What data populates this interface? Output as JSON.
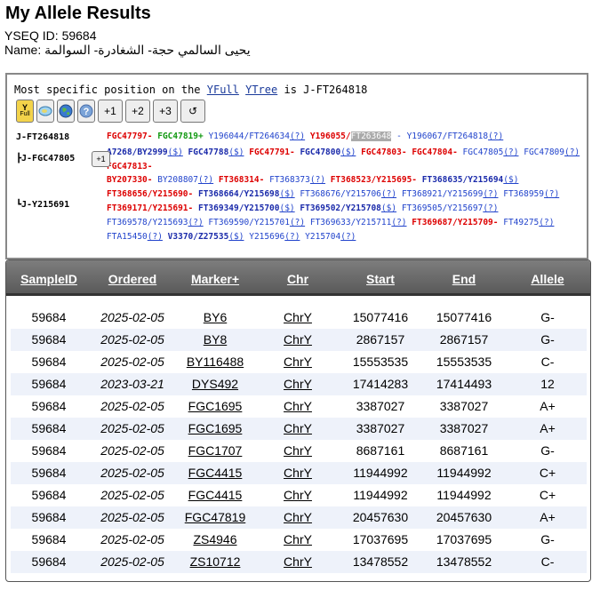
{
  "page": {
    "title": "My Allele Results",
    "yseq_id": "YSEQ ID: 59684",
    "name_line": "Name: يحيى السالمي حجة- الشغادرة- السوالمة"
  },
  "tree": {
    "position_prefix": "Most specific position on the",
    "yfull_link": "YFull",
    "ytree_link": "YTree",
    "position_suffix": "is J-FT264818",
    "toolbar": {
      "yfull_icon": "Y",
      "yfull_caption": "Full",
      "plus1": "+1",
      "plus2": "+2",
      "plus3": "+3",
      "reset": "↺"
    },
    "small_plus1": "+1",
    "branches": [
      {
        "label": "J-FT264818",
        "snps": [
          {
            "t": "FGC47797-",
            "c": "red"
          },
          {
            "t": "FGC47819+",
            "c": "green"
          },
          {
            "t": "Y196044/FT264634",
            "c": "blue"
          },
          {
            "t": "(?)",
            "c": "link"
          },
          {
            "t": "Y196055/",
            "c": "red"
          },
          {
            "t": "FT263648",
            "c": "hl"
          },
          {
            "t": "- Y196067/FT264818",
            "c": "blue"
          },
          {
            "t": "(?)",
            "c": "link"
          }
        ]
      },
      {
        "label": "┣J-FGC47805",
        "snps": [
          {
            "t": "A7268/BY2999",
            "c": "bluebold"
          },
          {
            "t": "($)",
            "c": "link"
          },
          {
            "t": "FGC47788",
            "c": "bluebold"
          },
          {
            "t": "($)",
            "c": "link"
          },
          {
            "t": "FGC47791-",
            "c": "red"
          },
          {
            "t": "FGC47800",
            "c": "bluebold"
          },
          {
            "t": "($)",
            "c": "link"
          },
          {
            "t": "FGC47803-",
            "c": "red"
          },
          {
            "t": "FGC47804-",
            "c": "red"
          },
          {
            "t": "FGC47805",
            "c": "blue"
          },
          {
            "t": "(?)",
            "c": "link"
          },
          {
            "t": "FGC47809",
            "c": "blue"
          },
          {
            "t": "(?)",
            "c": "link"
          },
          {
            "t": "FGC47813-",
            "c": "red"
          }
        ]
      },
      {
        "label": "┗J-Y215691",
        "snps": [
          {
            "t": "BY207330-",
            "c": "red"
          },
          {
            "t": "BY208807",
            "c": "blue"
          },
          {
            "t": "(?)",
            "c": "link"
          },
          {
            "t": "FT368314-",
            "c": "red"
          },
          {
            "t": "FT368373",
            "c": "blue"
          },
          {
            "t": "(?)",
            "c": "link"
          },
          {
            "t": "FT368523/Y215695-",
            "c": "red"
          },
          {
            "t": "FT368635/Y215694",
            "c": "bluebold"
          },
          {
            "t": "($)",
            "c": "link"
          },
          {
            "t": "FT368656/Y215690-",
            "c": "red"
          },
          {
            "t": "FT368664/Y215698",
            "c": "bluebold"
          },
          {
            "t": "($)",
            "c": "link"
          },
          {
            "t": "FT368676/Y215706",
            "c": "blue"
          },
          {
            "t": "(?)",
            "c": "link"
          },
          {
            "t": "FT368921/Y215699",
            "c": "blue"
          },
          {
            "t": "(?)",
            "c": "link"
          },
          {
            "t": "FT368959",
            "c": "blue"
          },
          {
            "t": "(?)",
            "c": "link"
          },
          {
            "t": "FT369171/Y215691-",
            "c": "red"
          },
          {
            "t": "FT369349/Y215700",
            "c": "bluebold"
          },
          {
            "t": "($)",
            "c": "link"
          },
          {
            "t": "FT369502/Y215708",
            "c": "bluebold"
          },
          {
            "t": "($)",
            "c": "link"
          },
          {
            "t": "FT369505/Y215697",
            "c": "blue"
          },
          {
            "t": "(?)",
            "c": "link"
          },
          {
            "t": "FT369578/Y215693",
            "c": "blue"
          },
          {
            "t": "(?)",
            "c": "link"
          },
          {
            "t": "FT369590/Y215701",
            "c": "blue"
          },
          {
            "t": "(?)",
            "c": "link"
          },
          {
            "t": "FT369633/Y215711",
            "c": "blue"
          },
          {
            "t": "(?)",
            "c": "link"
          },
          {
            "t": "FT369687/Y215709-",
            "c": "red"
          },
          {
            "t": "FT49275",
            "c": "blue"
          },
          {
            "t": "(?)",
            "c": "link"
          },
          {
            "t": "FTA15450",
            "c": "blue"
          },
          {
            "t": "(?)",
            "c": "link"
          },
          {
            "t": "V3370/Z27535",
            "c": "bluebold"
          },
          {
            "t": "($)",
            "c": "link"
          },
          {
            "t": "Y215696",
            "c": "blue"
          },
          {
            "t": "(?)",
            "c": "link"
          },
          {
            "t": "Y215704",
            "c": "blue"
          },
          {
            "t": "(?)",
            "c": "link"
          }
        ]
      }
    ]
  },
  "table": {
    "headers": [
      "SampleID",
      "Ordered",
      "Marker+",
      "Chr",
      "Start",
      "End",
      "Allele"
    ],
    "rows": [
      [
        "59684",
        "2025-02-05",
        "BY6",
        "ChrY",
        "15077416",
        "15077416",
        "G-"
      ],
      [
        "59684",
        "2025-02-05",
        "BY8",
        "ChrY",
        "2867157",
        "2867157",
        "G-"
      ],
      [
        "59684",
        "2025-02-05",
        "BY116488",
        "ChrY",
        "15553535",
        "15553535",
        "C-"
      ],
      [
        "59684",
        "2023-03-21",
        "DYS492",
        "ChrY",
        "17414283",
        "17414493",
        "12"
      ],
      [
        "59684",
        "2025-02-05",
        "FGC1695",
        "ChrY",
        "3387027",
        "3387027",
        "A+"
      ],
      [
        "59684",
        "2025-02-05",
        "FGC1695",
        "ChrY",
        "3387027",
        "3387027",
        "A+"
      ],
      [
        "59684",
        "2025-02-05",
        "FGC1707",
        "ChrY",
        "8687161",
        "8687161",
        "G-"
      ],
      [
        "59684",
        "2025-02-05",
        "FGC4415",
        "ChrY",
        "11944992",
        "11944992",
        "C+"
      ],
      [
        "59684",
        "2025-02-05",
        "FGC4415",
        "ChrY",
        "11944992",
        "11944992",
        "C+"
      ],
      [
        "59684",
        "2025-02-05",
        "FGC47819",
        "ChrY",
        "20457630",
        "20457630",
        "A+"
      ],
      [
        "59684",
        "2025-02-05",
        "ZS4946",
        "ChrY",
        "17037695",
        "17037695",
        "G-"
      ],
      [
        "59684",
        "2025-02-05",
        "ZS10712",
        "ChrY",
        "13478552",
        "13478552",
        "C-"
      ]
    ]
  },
  "colors": {
    "snp_red": "#dd0000",
    "snp_blue": "#2244cc",
    "snp_green": "#119911",
    "header_bg": "#6a6a6a",
    "row_alt": "#eef2fa"
  }
}
